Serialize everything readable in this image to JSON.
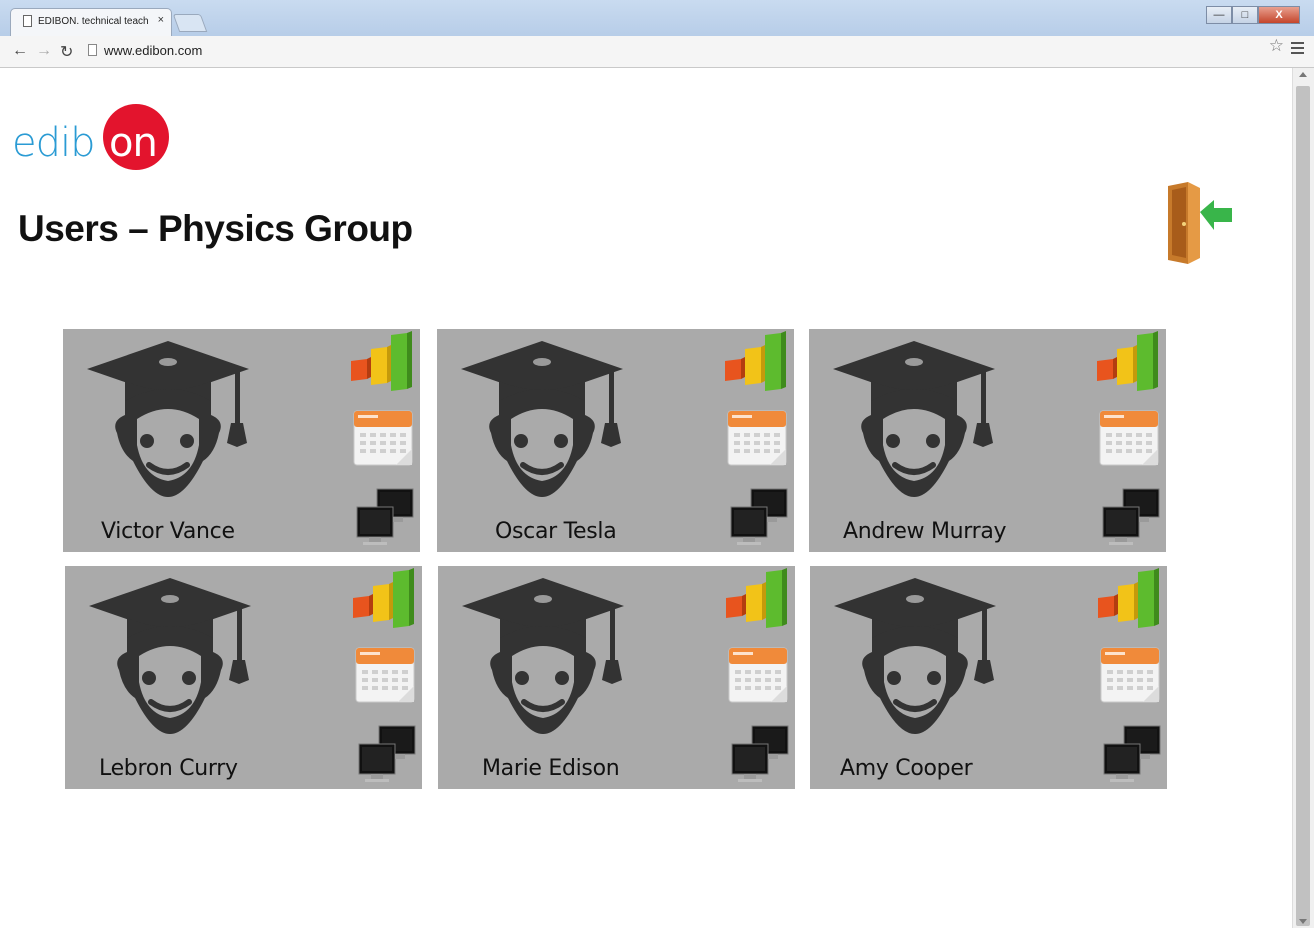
{
  "browser": {
    "tab_title": "EDIBON. technical teachi",
    "tab_close": "×",
    "url": "www.edibon.com",
    "window_buttons": [
      "—",
      "□",
      "X"
    ]
  },
  "page": {
    "logo_text": "edib",
    "logo_accent": "on",
    "title": "Users – Physics Group",
    "accent_color": "#e3142d",
    "card_color": "#aaaaaa"
  },
  "users": [
    {
      "name": "Victor Vance"
    },
    {
      "name": "Oscar Tesla"
    },
    {
      "name": "Andrew Murray"
    },
    {
      "name": "Lebron Curry"
    },
    {
      "name": "Marie Edison"
    },
    {
      "name": "Amy Cooper"
    }
  ],
  "icons": {
    "logout": "logout-door-icon",
    "avatar": "graduate-avatar-icon",
    "statistics": "bar-chart-icon",
    "calendar": "calendar-icon",
    "sessions": "monitors-icon"
  }
}
